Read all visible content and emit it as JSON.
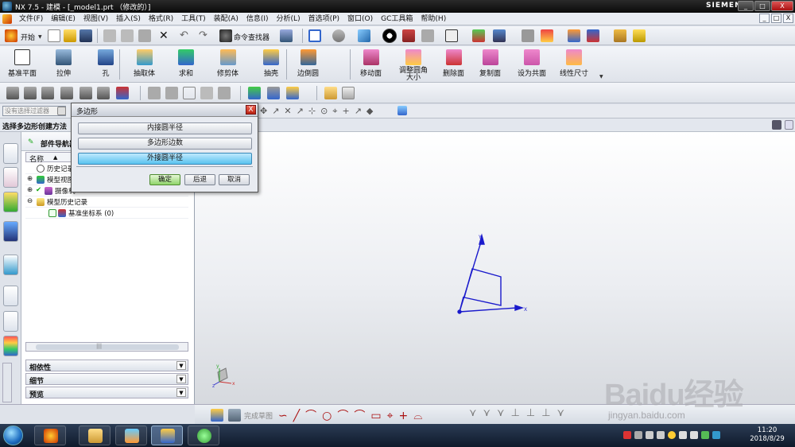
{
  "window": {
    "title": "NX 7.5 - 建模 - [_model1.prt （修改的）]",
    "brand": "SIEMENS",
    "btn_min": "_",
    "btn_max": "□",
    "btn_close": "X"
  },
  "menubar": {
    "items": [
      "文件(F)",
      "编辑(E)",
      "视图(V)",
      "插入(S)",
      "格式(R)",
      "工具(T)",
      "装配(A)",
      "信息(I)",
      "分析(L)",
      "首选项(P)",
      "窗口(O)",
      "GC工具箱",
      "帮助(H)"
    ],
    "mdi_min": "_",
    "mdi_max": "□",
    "mdi_close": "X"
  },
  "toolbar1": {
    "start_label": "开始",
    "cmd_finder_label": "命令查找器"
  },
  "toolbar2": {
    "buttons": [
      "基准平面",
      "拉伸",
      "孔",
      "抽取体",
      "求和",
      "修剪体",
      "抽壳",
      "边倒圆",
      "移动面",
      "调整圆角大小",
      "删除面",
      "复制面",
      "设为共面",
      "线性尺寸"
    ]
  },
  "selbar": {
    "filter_placeholder": "没有选择过滤器"
  },
  "hint": {
    "text": "选择多边形创建方法"
  },
  "navigator": {
    "title": "部件导航器",
    "col_name": "名称",
    "col_sort": "▲",
    "rows": [
      {
        "label": "历史记录模式"
      },
      {
        "label": "模型视图"
      },
      {
        "label": "摄像机"
      },
      {
        "label": "模型历史记录"
      },
      {
        "label": "基准坐标系 (0)"
      }
    ],
    "panels": [
      "相依性",
      "细节",
      "预览"
    ],
    "scroll_marker": "|||"
  },
  "dialog": {
    "title": "多边形",
    "close": "X",
    "options": [
      "内接圆半径",
      "多边形边数",
      "外接圆半径"
    ],
    "active_option": 2,
    "ok": "确定",
    "back": "后退",
    "cancel": "取消"
  },
  "graphics": {
    "axis_x": "X",
    "axis_y": "Y",
    "triad_x": "x",
    "triad_y": "y",
    "triad_z": "z"
  },
  "sketchbar": {
    "finish_label": "完成草图"
  },
  "taskbar": {
    "time": "11:20",
    "date": "2018/8/29"
  },
  "watermark": {
    "text": "Baidu经验",
    "url": "jingyan.baidu.com"
  },
  "colors": {
    "axis_blue": "#1a1acc",
    "dialog_active": "#59c3ef",
    "ok_green": "#8fd46a"
  }
}
